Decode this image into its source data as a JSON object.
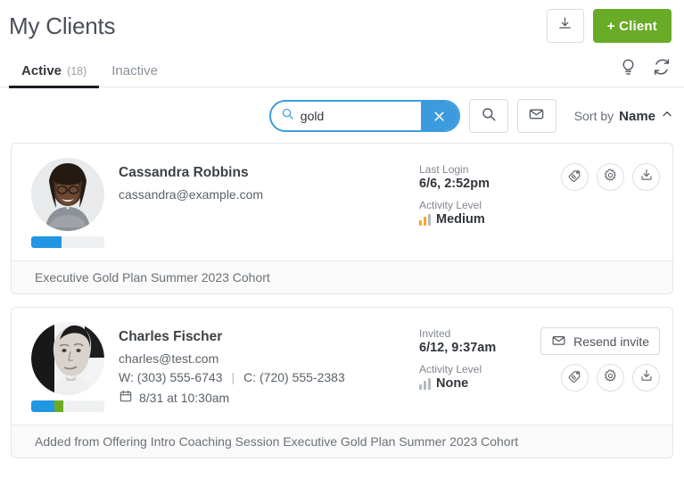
{
  "header": {
    "title": "My Clients",
    "download_icon": "download-icon",
    "add_client_label": "+ Client"
  },
  "tabs": {
    "items": [
      {
        "label": "Active",
        "count": "(18)",
        "active": true
      },
      {
        "label": "Inactive",
        "count": "",
        "active": false
      }
    ],
    "right_icons": [
      "lightbulb-icon",
      "refresh-icon"
    ]
  },
  "search": {
    "value": "gold",
    "placeholder": "Search",
    "clear_label": "×",
    "search_icon": "search-icon",
    "mail_icon": "envelope-icon"
  },
  "sort": {
    "label": "Sort by",
    "value": "Name",
    "direction_icon": "chevron-up-icon"
  },
  "colors": {
    "accent_green": "#68ab26",
    "accent_blue": "#3c9bdd",
    "progress_blue": "#2196e3",
    "progress_green": "#6cab21",
    "activity_orange": "#f5a623",
    "activity_gray": "#9aa0a8"
  },
  "clients": [
    {
      "name": "Cassandra Robbins",
      "email": "cassandra@example.com",
      "phones": "",
      "appointment": "",
      "progress": {
        "blue_pct": 42,
        "green_pct": 0
      },
      "meta_label": "Last Login",
      "meta_value": "6/6, 2:52pm",
      "activity_label": "Activity Level",
      "activity_value": "Medium",
      "activity_filled": 2,
      "has_resend": false,
      "resend_label": "",
      "footer": "Executive Gold Plan Summer 2023 Cohort",
      "actions": [
        "tag-icon",
        "gear-icon",
        "download-icon"
      ]
    },
    {
      "name": "Charles Fischer",
      "email": "charles@test.com",
      "phones": "W: (303) 555-6743 | C: (720) 555-2383",
      "phone_work": "W: (303) 555-6743",
      "phone_cell": "C: (720) 555-2383",
      "appointment": "8/31 at 10:30am",
      "progress": {
        "blue_pct": 32,
        "green_pct": 12
      },
      "meta_label": "Invited",
      "meta_value": "6/12, 9:37am",
      "activity_label": "Activity Level",
      "activity_value": "None",
      "activity_filled": 0,
      "has_resend": true,
      "resend_label": "Resend invite",
      "footer": "Added from Offering Intro Coaching Session Executive Gold Plan Summer 2023 Cohort",
      "actions": [
        "tag-icon",
        "gear-icon",
        "download-icon"
      ]
    }
  ]
}
